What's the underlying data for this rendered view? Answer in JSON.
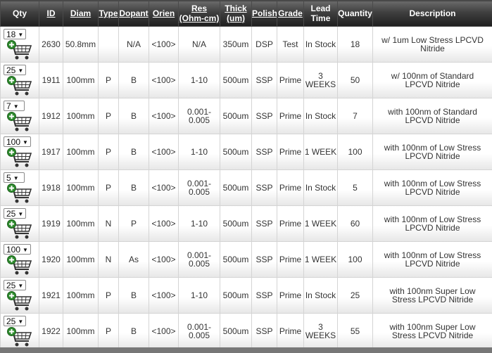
{
  "headers": [
    {
      "key": "qty",
      "label": "Qty",
      "line2": "",
      "underline": false
    },
    {
      "key": "id",
      "label": "ID",
      "line2": "",
      "underline": true
    },
    {
      "key": "diam",
      "label": "Diam",
      "line2": "",
      "underline": true
    },
    {
      "key": "type",
      "label": "Type",
      "line2": "",
      "underline": true
    },
    {
      "key": "dopant",
      "label": "Dopant",
      "line2": "",
      "underline": true
    },
    {
      "key": "orien",
      "label": "Orien",
      "line2": "",
      "underline": true
    },
    {
      "key": "res",
      "label": "Res",
      "line2": "(Ohm-cm)",
      "underline": true
    },
    {
      "key": "thick",
      "label": "Thick",
      "line2": "(um)",
      "underline": true
    },
    {
      "key": "polish",
      "label": "Polish",
      "line2": "",
      "underline": true
    },
    {
      "key": "grade",
      "label": "Grade",
      "line2": "",
      "underline": true
    },
    {
      "key": "lead",
      "label": "Lead",
      "line2": "Time",
      "underline": false
    },
    {
      "key": "quantity",
      "label": "Quantity",
      "line2": "",
      "underline": false
    },
    {
      "key": "desc",
      "label": "Description",
      "line2": "",
      "underline": false
    }
  ],
  "rows": [
    {
      "qty": "18",
      "id": "2630",
      "diam": "50.8mm",
      "type": "",
      "dopant": "N/A",
      "orien": "<100>",
      "res": "N/A",
      "thick": "350um",
      "polish": "DSP",
      "grade": "Test",
      "lead": "In Stock",
      "quantity": "18",
      "desc": "w/ 1um Low Stress LPCVD Nitride"
    },
    {
      "qty": "25",
      "id": "1911",
      "diam": "100mm",
      "type": "P",
      "dopant": "B",
      "orien": "<100>",
      "res": "1-10",
      "thick": "500um",
      "polish": "SSP",
      "grade": "Prime",
      "lead": "3 WEEKS",
      "quantity": "50",
      "desc": "w/ 100nm of Standard LPCVD Nitride"
    },
    {
      "qty": "7",
      "id": "1912",
      "diam": "100mm",
      "type": "P",
      "dopant": "B",
      "orien": "<100>",
      "res": "0.001-0.005",
      "thick": "500um",
      "polish": "SSP",
      "grade": "Prime",
      "lead": "In Stock",
      "quantity": "7",
      "desc": "with 100nm of Standard LPCVD Nitride"
    },
    {
      "qty": "100",
      "id": "1917",
      "diam": "100mm",
      "type": "P",
      "dopant": "B",
      "orien": "<100>",
      "res": "1-10",
      "thick": "500um",
      "polish": "SSP",
      "grade": "Prime",
      "lead": "1 WEEK",
      "quantity": "100",
      "desc": "with 100nm of Low Stress LPCVD Nitride"
    },
    {
      "qty": "5",
      "id": "1918",
      "diam": "100mm",
      "type": "P",
      "dopant": "B",
      "orien": "<100>",
      "res": "0.001-0.005",
      "thick": "500um",
      "polish": "SSP",
      "grade": "Prime",
      "lead": "In Stock",
      "quantity": "5",
      "desc": "with 100nm of Low Stress LPCVD Nitride"
    },
    {
      "qty": "25",
      "id": "1919",
      "diam": "100mm",
      "type": "N",
      "dopant": "P",
      "orien": "<100>",
      "res": "1-10",
      "thick": "500um",
      "polish": "SSP",
      "grade": "Prime",
      "lead": "1 WEEK",
      "quantity": "60",
      "desc": "with 100nm of Low Stress LPCVD Nitride"
    },
    {
      "qty": "100",
      "id": "1920",
      "diam": "100mm",
      "type": "N",
      "dopant": "As",
      "orien": "<100>",
      "res": "0.001-0.005",
      "thick": "500um",
      "polish": "SSP",
      "grade": "Prime",
      "lead": "1 WEEK",
      "quantity": "100",
      "desc": "with 100nm of Low Stress LPCVD Nitride"
    },
    {
      "qty": "25",
      "id": "1921",
      "diam": "100mm",
      "type": "P",
      "dopant": "B",
      "orien": "<100>",
      "res": "1-10",
      "thick": "500um",
      "polish": "SSP",
      "grade": "Prime",
      "lead": "In Stock",
      "quantity": "25",
      "desc": "with 100nm Super Low Stress LPCVD Nitride"
    },
    {
      "qty": "25",
      "id": "1922",
      "diam": "100mm",
      "type": "P",
      "dopant": "B",
      "orien": "<100>",
      "res": "0.001-0.005",
      "thick": "500um",
      "polish": "SSP",
      "grade": "Prime",
      "lead": "3 WEEKS",
      "quantity": "55",
      "desc": "with 100nm Super Low Stress LPCVD Nitride"
    }
  ],
  "icons": {
    "qty_dropdown": "chevron-down-icon",
    "add_to_cart": "add-to-cart-icon"
  },
  "colors": {
    "header_bg": "#2b2b2b",
    "header_text": "#ffffff",
    "cart_green": "#2e8b2e",
    "cart_stroke": "#333333",
    "row_text": "#333333"
  }
}
